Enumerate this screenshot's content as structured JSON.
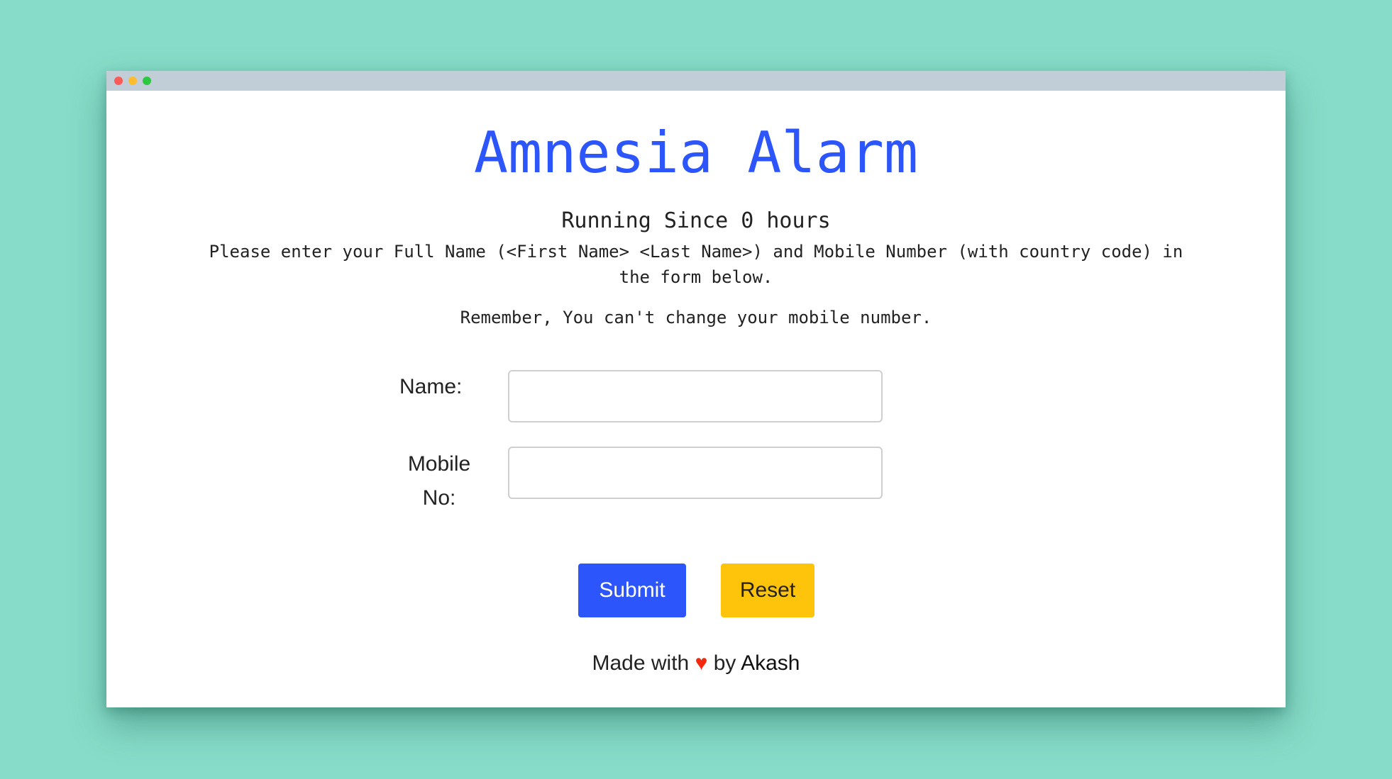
{
  "window": {
    "controls": [
      "close",
      "minimize",
      "maximize"
    ]
  },
  "page": {
    "title": "Amnesia Alarm",
    "running": "Running Since 0 hours",
    "instructions": "Please enter your Full Name (<First Name> <Last Name>) and Mobile Number (with country code) in the form below.",
    "reminder": "Remember, You can't change your mobile number."
  },
  "form": {
    "name_label": "Name:",
    "name_value": "",
    "mobile_label_line1": "Mobile",
    "mobile_label_line2": "No:",
    "mobile_value": ""
  },
  "buttons": {
    "submit_label": "Submit",
    "reset_label": "Reset"
  },
  "footer": {
    "prefix": "Made with",
    "heart": "♥",
    "by": "by",
    "author": "Akash"
  },
  "colors": {
    "background": "#86dcc8",
    "accent": "#2c55fb",
    "reset_button": "#fec40b",
    "heart": "#f4280d"
  }
}
